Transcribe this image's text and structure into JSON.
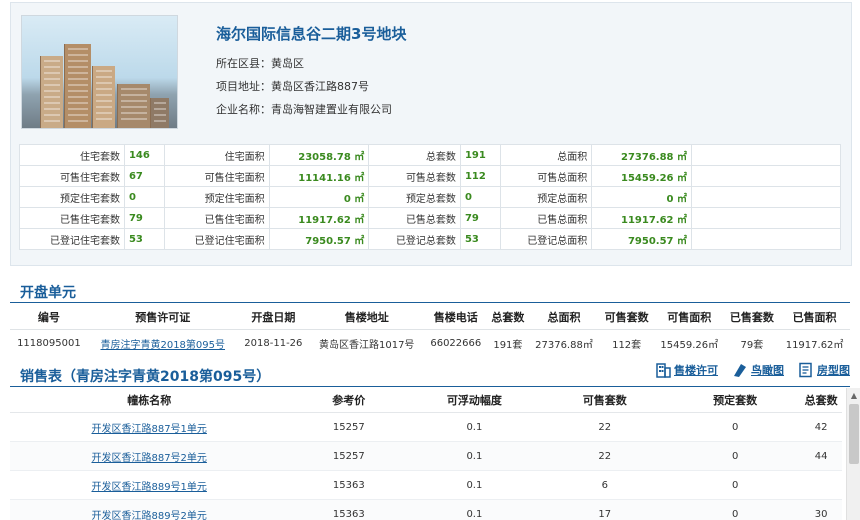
{
  "project": {
    "title": "海尔国际信息谷二期3号地块",
    "district_label": "所在区县：",
    "district": "黄岛区",
    "address_label": "项目地址：",
    "address": "黄岛区香江路887号",
    "company_label": "企业名称：",
    "company": "青岛海智建置业有限公司"
  },
  "stats": [
    {
      "l1": "住宅套数",
      "v1": "146",
      "l2": "住宅面积",
      "v2": "23058.78 ㎡",
      "l3": "总套数",
      "v3": "191",
      "l4": "总面积",
      "v4": "27376.88 ㎡"
    },
    {
      "l1": "可售住宅套数",
      "v1": "67",
      "l2": "可售住宅面积",
      "v2": "11141.16 ㎡",
      "l3": "可售总套数",
      "v3": "112",
      "l4": "可售总面积",
      "v4": "15459.26 ㎡"
    },
    {
      "l1": "预定住宅套数",
      "v1": "0",
      "l2": "预定住宅面积",
      "v2": "0 ㎡",
      "l3": "预定总套数",
      "v3": "0",
      "l4": "预定总面积",
      "v4": "0 ㎡"
    },
    {
      "l1": "已售住宅套数",
      "v1": "79",
      "l2": "已售住宅面积",
      "v2": "11917.62 ㎡",
      "l3": "已售总套数",
      "v3": "79",
      "l4": "已售总面积",
      "v4": "11917.62 ㎡"
    },
    {
      "l1": "已登记住宅套数",
      "v1": "53",
      "l2": "已登记住宅面积",
      "v2": "7950.57 ㎡",
      "l3": "已登记总套数",
      "v3": "53",
      "l4": "已登记总面积",
      "v4": "7950.57 ㎡"
    }
  ],
  "units_section": {
    "title": "开盘单元",
    "headers": [
      "编号",
      "预售许可证",
      "开盘日期",
      "售楼地址",
      "售楼电话",
      "总套数",
      "总面积",
      "可售套数",
      "可售面积",
      "已售套数",
      "已售面积"
    ],
    "row": [
      "1118095001",
      "青房注字青黄2018第095号",
      "2018-11-26",
      "黄岛区香江路1017号",
      "66022666",
      "191套",
      "27376.88㎡",
      "112套",
      "15459.26㎡",
      "79套",
      "11917.62㎡"
    ]
  },
  "sales_section": {
    "title": "销售表（青房注字青黄2018第095号）",
    "actions": {
      "permit": "售楼许可",
      "aerial": "鸟瞰图",
      "floorplan": "房型图"
    },
    "headers": [
      "幢栋名称",
      "参考价",
      "可浮动幅度",
      "可售套数",
      "预定套数",
      "总套数"
    ],
    "rows": [
      [
        "开发区香江路887号1单元",
        "15257",
        "0.1",
        "22",
        "0",
        "42"
      ],
      [
        "开发区香江路887号2单元",
        "15257",
        "0.1",
        "22",
        "0",
        "44"
      ],
      [
        "开发区香江路889号1单元",
        "15363",
        "0.1",
        "6",
        "0",
        ""
      ],
      [
        "开发区香江路889号2单元",
        "15363",
        "0.1",
        "17",
        "0",
        "30"
      ]
    ]
  }
}
